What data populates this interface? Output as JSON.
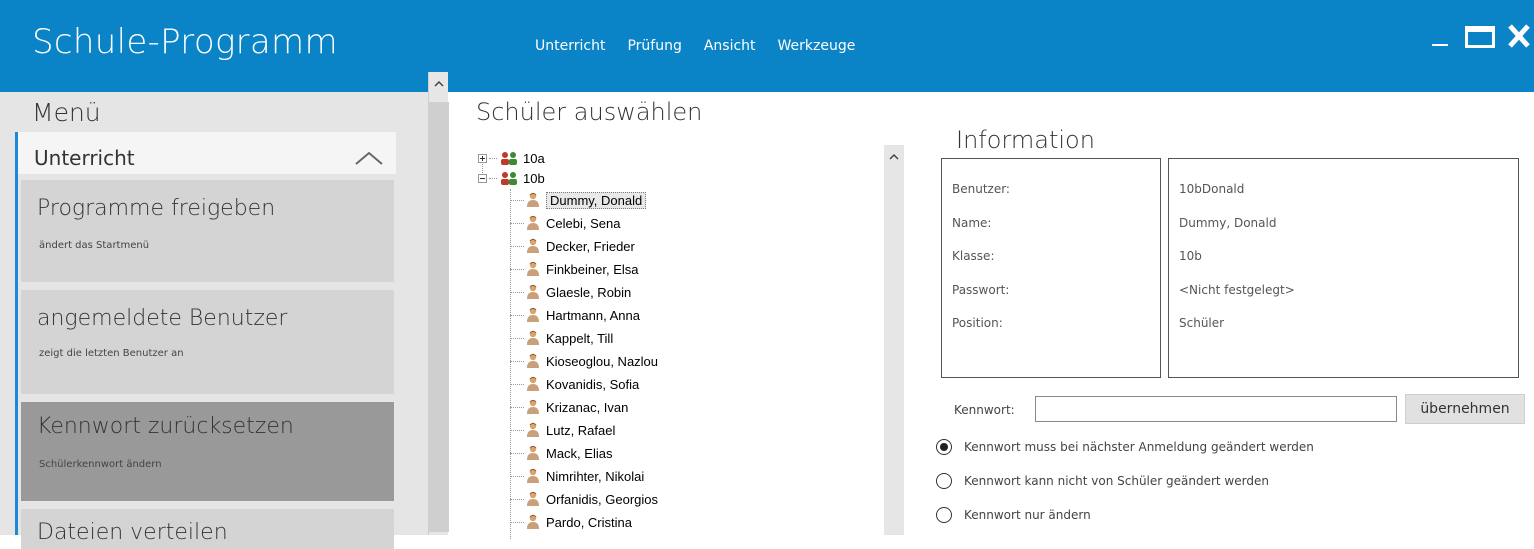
{
  "app": {
    "title": "Schule-Programm",
    "menu": [
      "Unterricht",
      "Prüfung",
      "Ansicht",
      "Werkzeuge"
    ]
  },
  "sidebar": {
    "heading": "Menü",
    "section": "Unterricht",
    "tiles": [
      {
        "title": "Programme freigeben",
        "subtitle": "ändert das Startmenü"
      },
      {
        "title": "angemeldete Benutzer",
        "subtitle": "zeigt die letzten Benutzer an"
      },
      {
        "title": "Kennwort zurücksetzen",
        "subtitle": "Schülerkennwort ändern"
      },
      {
        "title": "Dateien verteilen",
        "subtitle": ""
      }
    ]
  },
  "tree": {
    "heading": "Schüler auswählen",
    "groups": [
      "10a",
      "10b"
    ],
    "students": [
      "Dummy, Donald",
      "Celebi, Sena",
      "Decker, Frieder",
      "Finkbeiner, Elsa",
      "Glaesle, Robin",
      "Hartmann, Anna",
      "Kappelt, Till",
      "Kioseoglou, Nazlou",
      "Kovanidis, Sofia",
      "Krizanac, Ivan",
      "Lutz, Rafael",
      "Mack, Elias",
      "Nimrihter, Nikolai",
      "Orfanidis, Georgios",
      "Pardo, Cristina"
    ]
  },
  "info": {
    "heading": "Information",
    "labels": {
      "user": "Benutzer:",
      "name": "Name:",
      "class": "Klasse:",
      "password": "Passwort:",
      "position": "Position:"
    },
    "values": {
      "user": "10bDonald",
      "name": "Dummy, Donald",
      "class": "10b",
      "password": "<Nicht festgelegt>",
      "position": "Schüler"
    }
  },
  "password": {
    "label": "Kennwort:",
    "value": "",
    "button": "übernehmen",
    "options": [
      {
        "label": "Kennwort muss bei nächster Anmeldung geändert werden",
        "checked": true
      },
      {
        "label": "Kennwort kann nicht von Schüler geändert werden",
        "checked": false
      },
      {
        "label": "Kennwort nur ändern",
        "checked": false
      }
    ]
  },
  "colors": {
    "accent": "#0a84c6",
    "sidebar": "#e5e5e5",
    "tile": "#d4d4d4",
    "tile_active": "#999999"
  }
}
